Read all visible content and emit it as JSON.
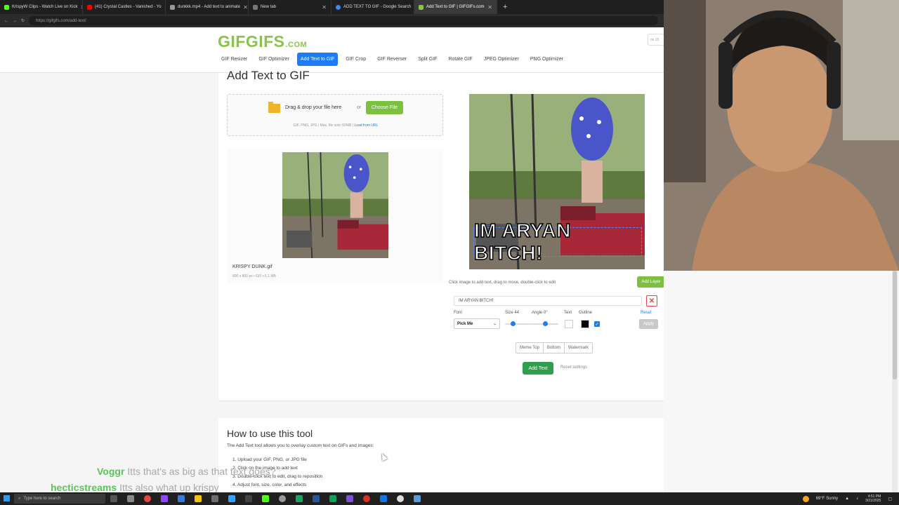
{
  "browser": {
    "tabs": [
      {
        "label": "KrispyW Clips - Watch Live on Kick",
        "color": "#53fc18"
      },
      {
        "label": "(41) Crystal Castles - Vanished - Yo",
        "color": "#ff0000"
      },
      {
        "label": "dunkkk.mp4 - Add text to animate",
        "color": "#999999"
      },
      {
        "label": "New tab",
        "color": "#777777"
      },
      {
        "label": "ADD TEXT TO GIF - Google Search",
        "color": "#4285f4"
      },
      {
        "label": "Add Text to GIF | GIFGIFs.com",
        "color": "#8bc34a"
      }
    ],
    "active_tab": 5,
    "close_glyph": "✕",
    "new_tab_glyph": "+",
    "url": "https://gifgifs.com/add-text/"
  },
  "site": {
    "logo_main": "GIFGIFS",
    "logo_suffix": ".COM",
    "login_label": "ox 15",
    "nav": [
      {
        "label": "GIF Resizer"
      },
      {
        "label": "GIF Optimizer"
      },
      {
        "label": "Add Text to GIF"
      },
      {
        "label": "GIF Crop"
      },
      {
        "label": "GIF Reverser"
      },
      {
        "label": "Split GIF"
      },
      {
        "label": "Rotate GIF"
      },
      {
        "label": "JPEG Optimizer"
      },
      {
        "label": "PNG Optimizer"
      }
    ],
    "active_nav": 2
  },
  "tool": {
    "title": "Add Text to GIF",
    "drop_text": "Drag & drop your file here",
    "drop_or": "or",
    "choose_label": "Choose File",
    "drop_meta": "GIF, PNG, JPG | Max. file size: 50MB |",
    "load_url_label": "Load from URL",
    "file_name": "KRISPY DUNK.gif",
    "file_meta": "800 x 800 px • GIF • 5.1 MB",
    "overlay_text": "IM ARYAN BITCH!",
    "hint": "Click image to add text, drag to move, double-click to edit",
    "add_layer_label": "Add Layer",
    "layer_text_value": "IM ARYAN BITCH!",
    "delete_glyph": "✕",
    "font_label": "Font",
    "font_value": "Pick Me",
    "size_label": "Size 44",
    "size_fraction": 0.3,
    "angle_label": "Angle 0°",
    "angle_fraction": 0.5,
    "text_label": "Text",
    "text_color": "#ffffff",
    "outline_label": "Outline",
    "outline_color": "#000000",
    "outline_enabled": true,
    "reset_label": "Reset",
    "apply_label": "Apply",
    "presets": [
      "Meme Top",
      "Bottom",
      "Watermark"
    ],
    "add_text_label": "Add Text",
    "reset_settings_label": "Reset settings"
  },
  "howto": {
    "title": "How to use this tool",
    "intro": "The Add Text tool allows you to overlay custom text on GIFs and images:",
    "steps": [
      "1. Upload your GIF, PNG, or JPG file",
      "2. Click on the image to add text",
      "3. Double-click text to edit, drag to reposition",
      "4. Adjust font, size, color, and effects"
    ]
  },
  "chat": [
    {
      "name": "Voggr",
      "message": "Itts that's as big as that text goes?"
    },
    {
      "name": "hecticstreams",
      "message": "Itts also what up krispy"
    }
  ],
  "taskbar": {
    "search_placeholder": "Type here to search",
    "weather": "69°F Sunny",
    "time": "4:51 PM",
    "date": "3/21/2025"
  },
  "colors": {
    "accent_blue": "#1e7cf2",
    "brand_green": "#8bc34a",
    "button_green": "#7cc040",
    "add_text_green": "#2e9e4f",
    "delete_red": "#e04444"
  }
}
